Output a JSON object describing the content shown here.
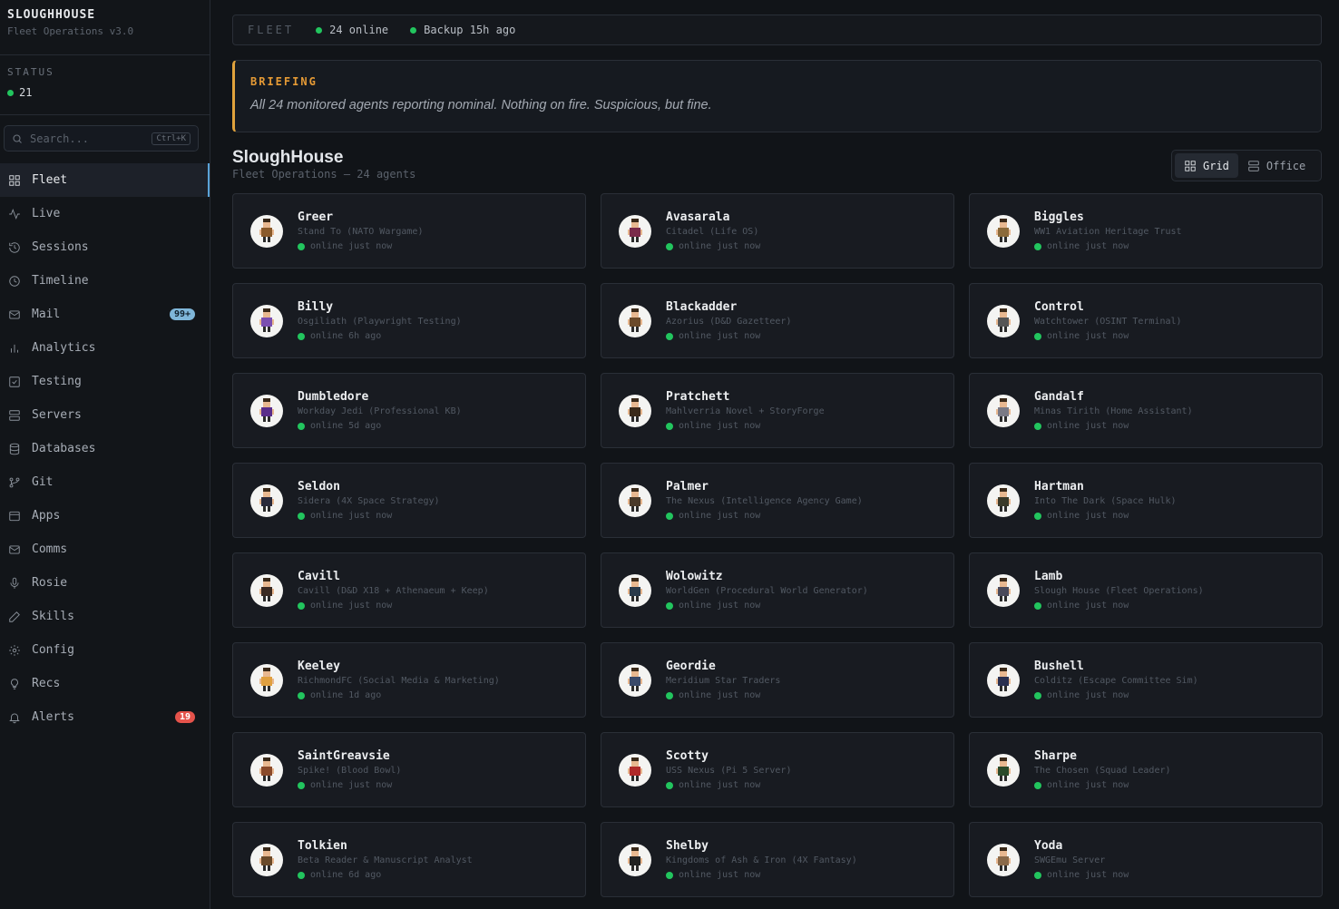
{
  "brand": {
    "name": "SLOUGHHOUSE",
    "subtitle": "Fleet Operations v3.0"
  },
  "status": {
    "label": "STATUS",
    "count": "21"
  },
  "search": {
    "placeholder": "Search...",
    "shortcut": "Ctrl+K"
  },
  "nav": [
    {
      "label": "Fleet",
      "icon": "grid-icon",
      "active": true
    },
    {
      "label": "Live",
      "icon": "activity-icon"
    },
    {
      "label": "Sessions",
      "icon": "history-icon"
    },
    {
      "label": "Timeline",
      "icon": "clock-icon"
    },
    {
      "label": "Mail",
      "icon": "mail-icon",
      "badge": "99+",
      "badge_color": "blue"
    },
    {
      "label": "Analytics",
      "icon": "bar-chart-icon"
    },
    {
      "label": "Testing",
      "icon": "check-square-icon"
    },
    {
      "label": "Servers",
      "icon": "server-icon"
    },
    {
      "label": "Databases",
      "icon": "database-icon"
    },
    {
      "label": "Git",
      "icon": "git-branch-icon"
    },
    {
      "label": "Apps",
      "icon": "app-window-icon"
    },
    {
      "label": "Comms",
      "icon": "mail-icon"
    },
    {
      "label": "Rosie",
      "icon": "mic-icon"
    },
    {
      "label": "Skills",
      "icon": "pen-icon"
    },
    {
      "label": "Config",
      "icon": "gear-icon"
    },
    {
      "label": "Recs",
      "icon": "lightbulb-icon"
    },
    {
      "label": "Alerts",
      "icon": "bell-icon",
      "badge": "19",
      "badge_color": "red"
    }
  ],
  "topbar": {
    "fleet_label": "FLEET",
    "online": "24 online",
    "backup": "Backup 15h ago"
  },
  "briefing": {
    "title": "BRIEFING",
    "text": "All 24 monitored agents reporting nominal. Nothing on fire. Suspicious, but fine."
  },
  "page": {
    "title": "SloughHouse",
    "subtitle": "Fleet Operations — 24 agents"
  },
  "view_toggle": {
    "grid": "Grid",
    "office": "Office"
  },
  "colors": {
    "accent": "#5aa3d8",
    "online": "#22c55e",
    "briefing": "#e59a35",
    "alert": "#e5534b"
  },
  "agents": [
    {
      "name": "Greer",
      "project": "Stand To (NATO Wargame)",
      "status": "online",
      "seen": "just now",
      "color": "#8a5a2b"
    },
    {
      "name": "Avasarala",
      "project": "Citadel (Life OS)",
      "status": "online",
      "seen": "just now",
      "color": "#7a2a4a"
    },
    {
      "name": "Biggles",
      "project": "WW1 Aviation Heritage Trust",
      "status": "online",
      "seen": "just now",
      "color": "#8b6a3a"
    },
    {
      "name": "Billy",
      "project": "Osgiliath (Playwright Testing)",
      "status": "online",
      "seen": "6h ago",
      "color": "#7b4fb0"
    },
    {
      "name": "Blackadder",
      "project": "Azorius (D&D Gazetteer)",
      "status": "online",
      "seen": "just now",
      "color": "#6b4a2a"
    },
    {
      "name": "Control",
      "project": "Watchtower (OSINT Terminal)",
      "status": "online",
      "seen": "just now",
      "color": "#555555"
    },
    {
      "name": "Dumbledore",
      "project": "Workday Jedi (Professional KB)",
      "status": "online",
      "seen": "5d ago",
      "color": "#5a2d8a"
    },
    {
      "name": "Pratchett",
      "project": "Mahlverria Novel + StoryForge",
      "status": "online",
      "seen": "just now",
      "color": "#3a2a1a"
    },
    {
      "name": "Gandalf",
      "project": "Minas Tirith (Home Assistant)",
      "status": "online",
      "seen": "just now",
      "color": "#7a7a85"
    },
    {
      "name": "Seldon",
      "project": "Sidera (4X Space Strategy)",
      "status": "online",
      "seen": "just now",
      "color": "#2a2a3a"
    },
    {
      "name": "Palmer",
      "project": "The Nexus (Intelligence Agency Game)",
      "status": "online",
      "seen": "just now",
      "color": "#4a3a2a"
    },
    {
      "name": "Hartman",
      "project": "Into The Dark (Space Hulk)",
      "status": "online",
      "seen": "just now",
      "color": "#3a3a2a"
    },
    {
      "name": "Cavill",
      "project": "Cavill (D&D X18 + Athenaeum + Keep)",
      "status": "online",
      "seen": "just now",
      "color": "#3a2a22"
    },
    {
      "name": "Wolowitz",
      "project": "WorldGen (Procedural World Generator)",
      "status": "online",
      "seen": "just now",
      "color": "#2a3a4a"
    },
    {
      "name": "Lamb",
      "project": "Slough House (Fleet Operations)",
      "status": "online",
      "seen": "just now",
      "color": "#4a4a5a"
    },
    {
      "name": "Keeley",
      "project": "RichmondFC (Social Media & Marketing)",
      "status": "online",
      "seen": "1d ago",
      "color": "#e0a040"
    },
    {
      "name": "Geordie",
      "project": "Meridium Star Traders",
      "status": "online",
      "seen": "just now",
      "color": "#3a4a6a"
    },
    {
      "name": "Bushell",
      "project": "Colditz (Escape Committee Sim)",
      "status": "online",
      "seen": "just now",
      "color": "#2a3050"
    },
    {
      "name": "SaintGreavsie",
      "project": "Spike! (Blood Bowl)",
      "status": "online",
      "seen": "just now",
      "color": "#8a4a2a"
    },
    {
      "name": "Scotty",
      "project": "USS Nexus (Pi 5 Server)",
      "status": "online",
      "seen": "just now",
      "color": "#b02a2a"
    },
    {
      "name": "Sharpe",
      "project": "The Chosen (Squad Leader)",
      "status": "online",
      "seen": "just now",
      "color": "#2a4a2a"
    },
    {
      "name": "Tolkien",
      "project": "Beta Reader & Manuscript Analyst",
      "status": "online",
      "seen": "6d ago",
      "color": "#6a4a2a"
    },
    {
      "name": "Shelby",
      "project": "Kingdoms of Ash & Iron (4X Fantasy)",
      "status": "online",
      "seen": "just now",
      "color": "#222222"
    },
    {
      "name": "Yoda",
      "project": "SWGEmu Server",
      "status": "online",
      "seen": "just now",
      "color": "#8a6a4a"
    }
  ]
}
